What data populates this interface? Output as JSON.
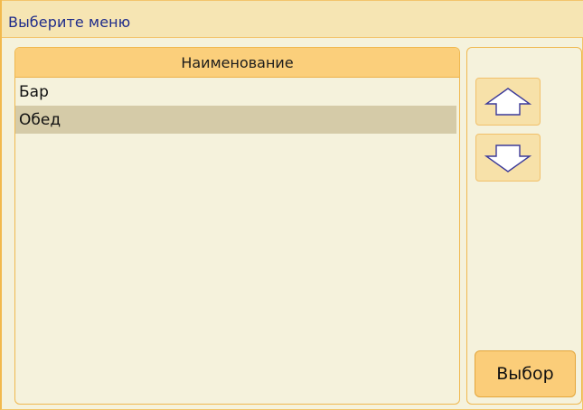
{
  "window": {
    "title": "Выберите меню"
  },
  "list": {
    "column_header": "Наименование",
    "rows": [
      {
        "label": "Бар",
        "selected": false
      },
      {
        "label": "Обед",
        "selected": true
      }
    ]
  },
  "sidebar": {
    "up_button_icon": "arrow-up-icon",
    "down_button_icon": "arrow-down-icon",
    "select_label": "Выбор"
  },
  "colors": {
    "title_text": "#1e2b8a",
    "accent": "#fbcf7b",
    "selection": "#d5cba8",
    "arrow_stroke": "#3c3a9a"
  }
}
